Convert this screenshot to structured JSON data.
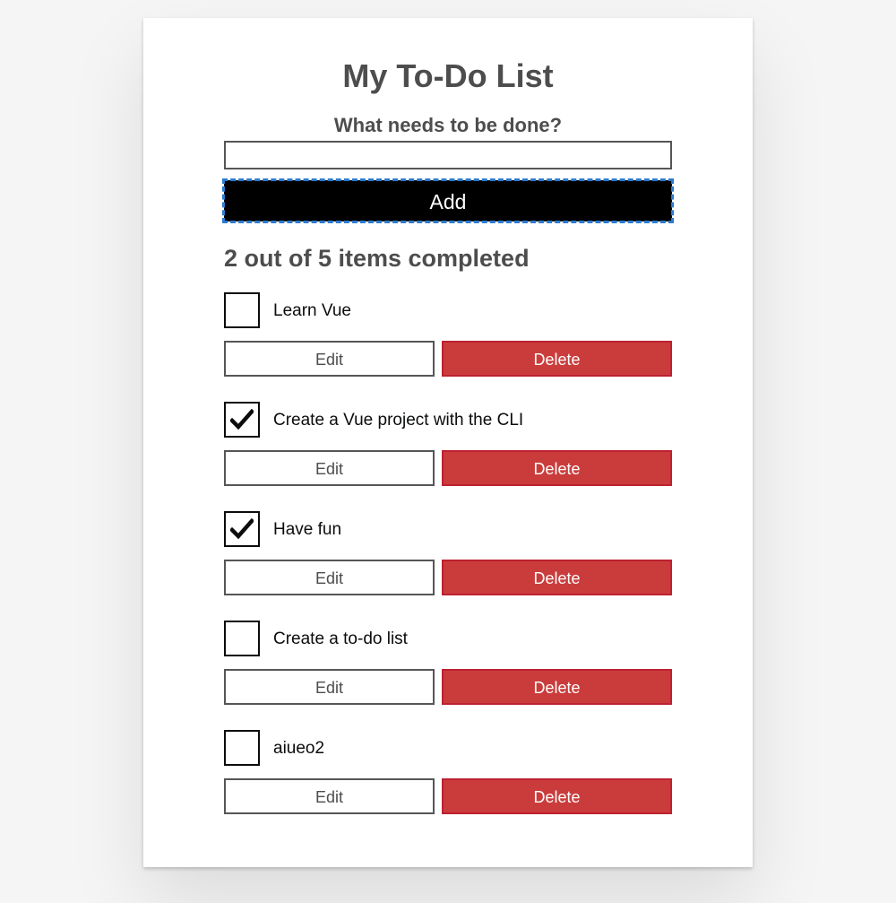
{
  "app": {
    "title": "My To-Do List"
  },
  "form": {
    "label": "What needs to be done?",
    "input_value": "",
    "add_label": "Add"
  },
  "summary": "2 out of 5 items completed",
  "todos": [
    {
      "label": "Learn Vue",
      "done": false,
      "edit_label": "Edit",
      "delete_label": "Delete"
    },
    {
      "label": "Create a Vue project with the CLI",
      "done": true,
      "edit_label": "Edit",
      "delete_label": "Delete"
    },
    {
      "label": "Have fun",
      "done": true,
      "edit_label": "Edit",
      "delete_label": "Delete"
    },
    {
      "label": "Create a to-do list",
      "done": false,
      "edit_label": "Edit",
      "delete_label": "Delete"
    },
    {
      "label": "aiueo2",
      "done": false,
      "edit_label": "Edit",
      "delete_label": "Delete"
    }
  ],
  "colors": {
    "background": "#f5f5f5",
    "card": "#ffffff",
    "text": "#4d4d4d",
    "add_button": "#000000",
    "focus_outline": "#2b7bd0",
    "delete_button": "#ca3c3c"
  },
  "icons": {
    "checkmark": "check-icon"
  }
}
